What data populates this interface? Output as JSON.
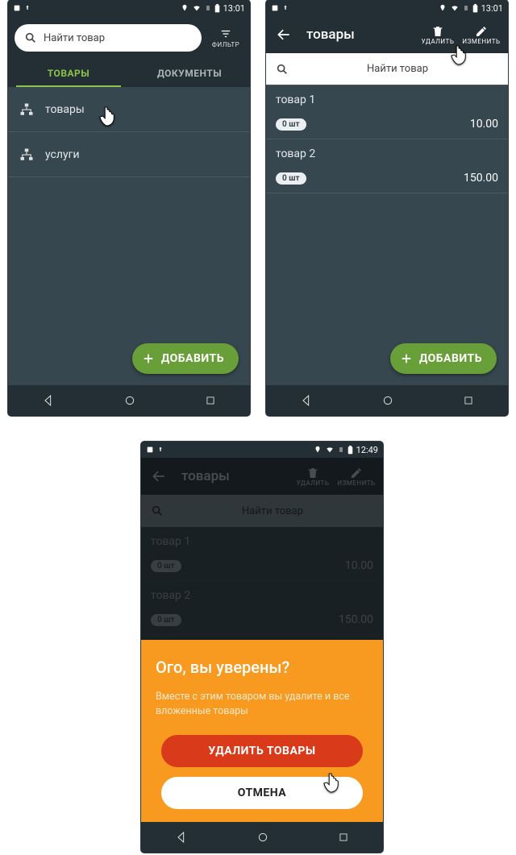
{
  "status": {
    "time1": "13:01",
    "time2": "13:01",
    "time3": "12:49"
  },
  "screen1": {
    "search_placeholder": "Найти товар",
    "filter_label": "ФИЛЬТР",
    "tab_goods": "ТОВАРЫ",
    "tab_documents": "ДОКУМЕНТЫ",
    "category_goods": "товары",
    "category_services": "услуги",
    "add_button": "ДОБАВИТЬ"
  },
  "screen2": {
    "back_icon": "arrow-left",
    "title": "товары",
    "action_delete": "УДАЛИТЬ",
    "action_edit": "ИЗМЕНИТЬ",
    "search_placeholder": "Найти товар",
    "products": [
      {
        "name": "товар 1",
        "qty": "0 шт",
        "price": "10.00"
      },
      {
        "name": "товар 2",
        "qty": "0 шт",
        "price": "150.00"
      }
    ],
    "add_button": "ДОБАВИТЬ"
  },
  "screen3": {
    "title": "товары",
    "action_delete": "УДАЛИТЬ",
    "action_edit": "ИЗМЕНИТЬ",
    "search_placeholder": "Найти товар",
    "products": [
      {
        "name": "товар 1",
        "qty": "0 шт",
        "price": "10.00"
      },
      {
        "name": "товар 2",
        "qty": "0 шт",
        "price": "150.00"
      }
    ],
    "dialog": {
      "title": "Ого, вы уверены?",
      "body": "Вместе с этим товаром вы удалите и все вложенные товары",
      "confirm": "УДАЛИТЬ ТОВАРЫ",
      "cancel": "ОТМЕНА"
    }
  }
}
